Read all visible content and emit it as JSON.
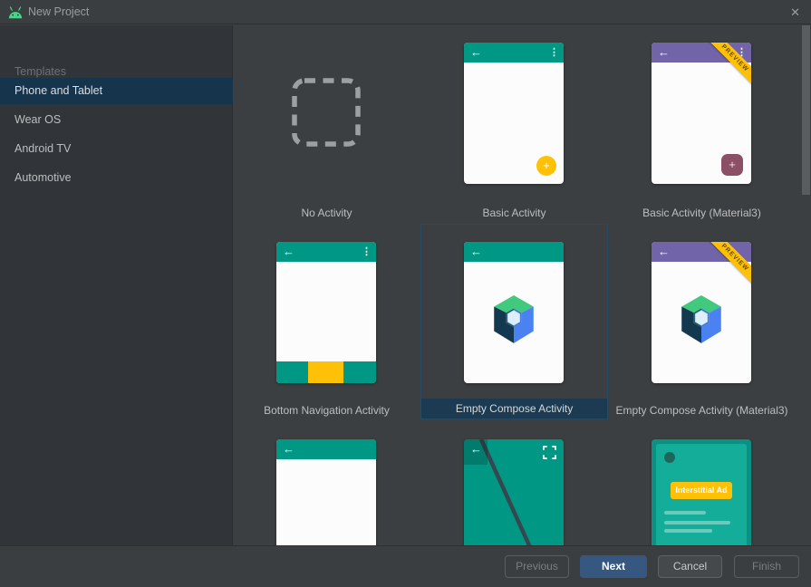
{
  "window": {
    "title": "New Project"
  },
  "icons": {
    "back": "←",
    "more": "⋮",
    "close": "✕",
    "plus": "+"
  },
  "sidebar": {
    "header": "Templates",
    "items": [
      {
        "label": "Phone and Tablet",
        "selected": true
      },
      {
        "label": "Wear OS",
        "selected": false
      },
      {
        "label": "Android TV",
        "selected": false
      },
      {
        "label": "Automotive",
        "selected": false
      }
    ]
  },
  "templates": [
    {
      "label": "No Activity"
    },
    {
      "label": "Basic Activity"
    },
    {
      "label": "Basic Activity (Material3)",
      "badge": "PREVIEW"
    },
    {
      "label": "Bottom Navigation Activity"
    },
    {
      "label": "Empty Compose Activity",
      "selected": true
    },
    {
      "label": "Empty Compose Activity (Material3)",
      "badge": "PREVIEW"
    },
    {
      "ad_button": "Interstitial Ad"
    }
  ],
  "footer": {
    "previous": "Previous",
    "next": "Next",
    "cancel": "Cancel",
    "finish": "Finish"
  },
  "colors": {
    "teal": "#009784",
    "purple": "#7264a9",
    "amber": "#ffc107",
    "selection_navy": "#1c3a52",
    "next_button_blue": "#365880"
  }
}
